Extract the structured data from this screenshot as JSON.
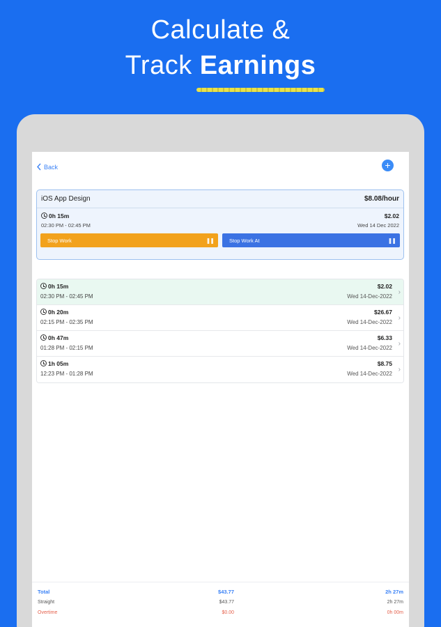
{
  "promo": {
    "line1": "Calculate &",
    "line2_prefix": "Track ",
    "line2_bold": "Earnings"
  },
  "nav": {
    "back_label": "Back",
    "add_icon": "plus-icon"
  },
  "active_job": {
    "title": "iOS App Design",
    "rate": "$8.08/hour",
    "duration": "0h 15m",
    "time_range": "02:30 PM - 02:45 PM",
    "amount": "$2.02",
    "date": "Wed 14 Dec 2022",
    "stop_label": "Stop Work",
    "stop_at_label": "Stop Work At"
  },
  "entries": [
    {
      "duration": "0h 15m",
      "range": "02:30 PM - 02:45 PM",
      "amount": "$2.02",
      "date": "Wed 14-Dec-2022"
    },
    {
      "duration": "0h 20m",
      "range": "02:15 PM - 02:35 PM",
      "amount": "$26.67",
      "date": "Wed 14-Dec-2022"
    },
    {
      "duration": "0h 47m",
      "range": "01:28 PM - 02:15 PM",
      "amount": "$6.33",
      "date": "Wed 14-Dec-2022"
    },
    {
      "duration": "1h 05m",
      "range": "12:23 PM - 01:28 PM",
      "amount": "$8.75",
      "date": "Wed 14-Dec-2022"
    }
  ],
  "summary": {
    "total": {
      "label": "Total",
      "amount": "$43.77",
      "time": "2h 27m"
    },
    "straight": {
      "label": "Straight",
      "amount": "$43.77",
      "time": "2h 27m"
    },
    "overtime": {
      "label": "Overtime",
      "amount": "$0.00",
      "time": "0h 00m"
    }
  },
  "colors": {
    "background": "#1a6ef0",
    "stop_button": "#f2a21c",
    "stop_at_button": "#3b72e3",
    "accent": "#3b82f6",
    "overtime": "#e5614c"
  }
}
